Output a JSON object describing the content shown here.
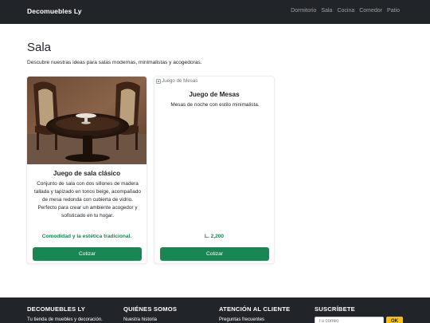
{
  "navbar": {
    "brand": "Decomuebles Ly",
    "links": [
      "Dormitorio",
      "Sala",
      "Cocina",
      "Comedor",
      "Patio"
    ]
  },
  "page": {
    "title": "Sala",
    "description": "Descubre nuestras ideas para salas modernas, minimalistas y acogedoras."
  },
  "cards": [
    {
      "title": "Juego de sala clásico",
      "text": "Conjunto de sala con dos sillones de madera tallada y tapizado en tonos beige, acompañado de mesa redonda con cubierta de vidrio. Perfecto para crear un ambiente acogedor y sofisticado en tu hogar.",
      "price": "Comodidad y la estética tradicional.",
      "button": "Cotizar"
    },
    {
      "image_alt": "Juego de Mesas",
      "title": "Juego de Mesas",
      "text": "Mesas de noche con estilo minimalista.",
      "price": "L. 2,200",
      "button": "Cotizar"
    }
  ],
  "footer": {
    "col1": {
      "heading": "DECOMUEBLES LY",
      "text": "Tu tienda de muebles y decoración."
    },
    "col2": {
      "heading": "QUIÉNES SOMOS",
      "text": "Nuestra historia"
    },
    "col3": {
      "heading": "ATENCIÓN AL CLIENTE",
      "text": "Preguntas frecuentes"
    },
    "col4": {
      "heading": "SUSCRÍBETE",
      "placeholder": "Tu correo",
      "button": "OK"
    }
  },
  "colors": {
    "accent": "#198754",
    "dark": "#212529",
    "subscribe": "#ffc107"
  }
}
